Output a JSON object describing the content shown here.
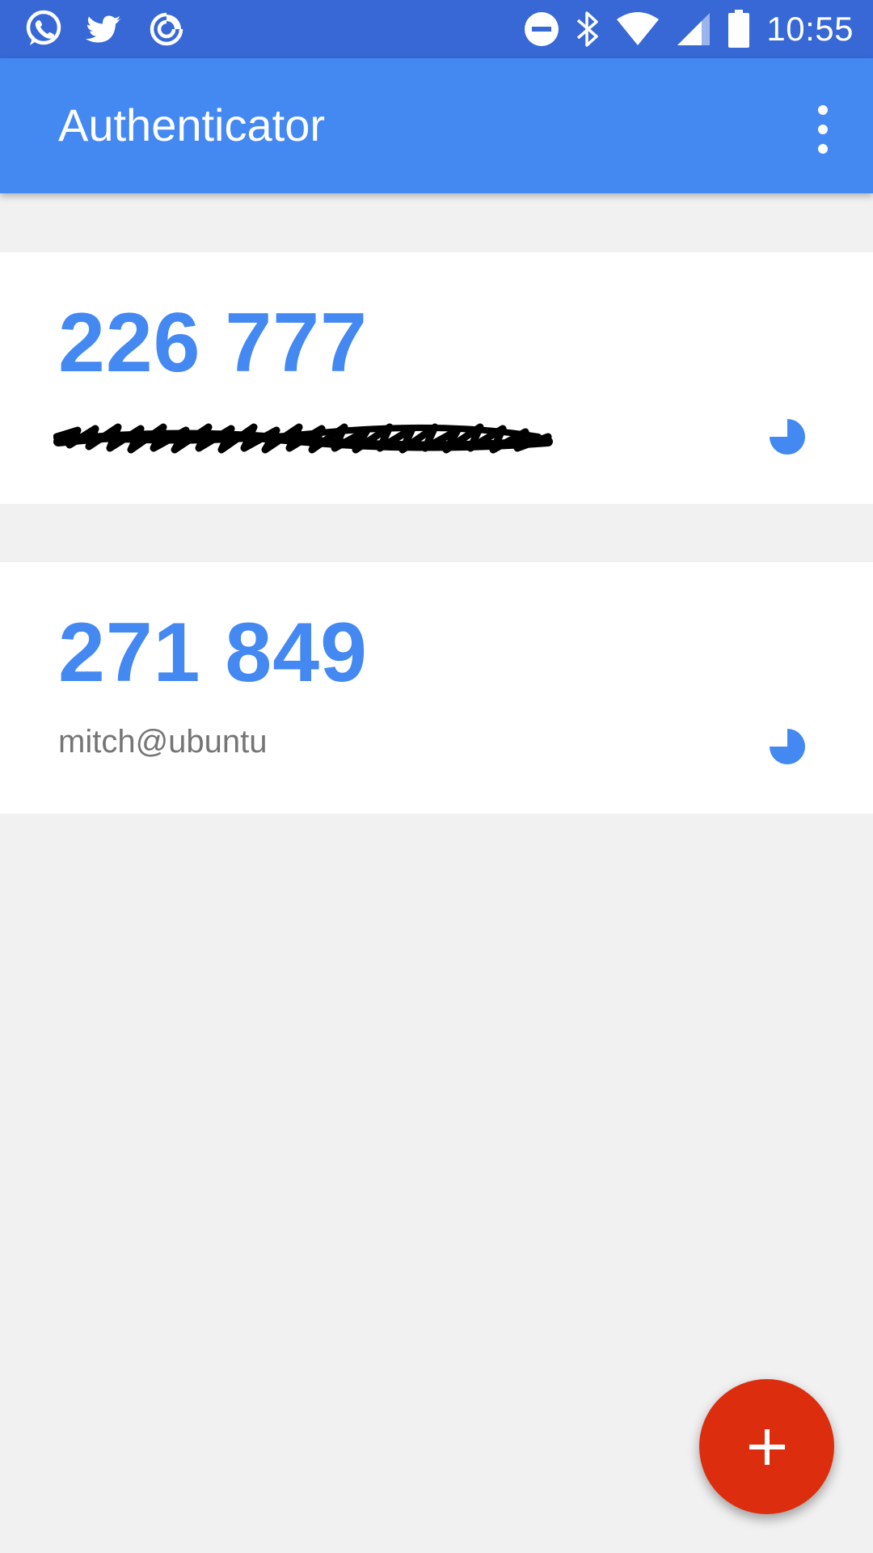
{
  "status_bar": {
    "time": "10:55",
    "notification_icons": [
      "whatsapp-icon",
      "twitter-icon",
      "pocketcasts-icon"
    ],
    "system_icons": [
      "do-not-disturb-icon",
      "bluetooth-icon",
      "wifi-icon",
      "cell-signal-icon",
      "battery-icon"
    ]
  },
  "app_bar": {
    "title": "Authenticator",
    "menu_icon": "more-vert-icon"
  },
  "accounts": [
    {
      "code": "226 777",
      "account": "",
      "account_redacted": true,
      "timer_icon": "countdown-pie-icon"
    },
    {
      "code": "271 849",
      "account": "mitch@ubuntu",
      "account_redacted": false,
      "timer_icon": "countdown-pie-icon"
    }
  ],
  "fab": {
    "icon": "plus-icon"
  },
  "colors": {
    "status_bar": "#3768d6",
    "app_bar": "#4488f2",
    "code_text": "#4488f2",
    "background": "#f1f1f1",
    "fab": "#dc2d0e"
  }
}
